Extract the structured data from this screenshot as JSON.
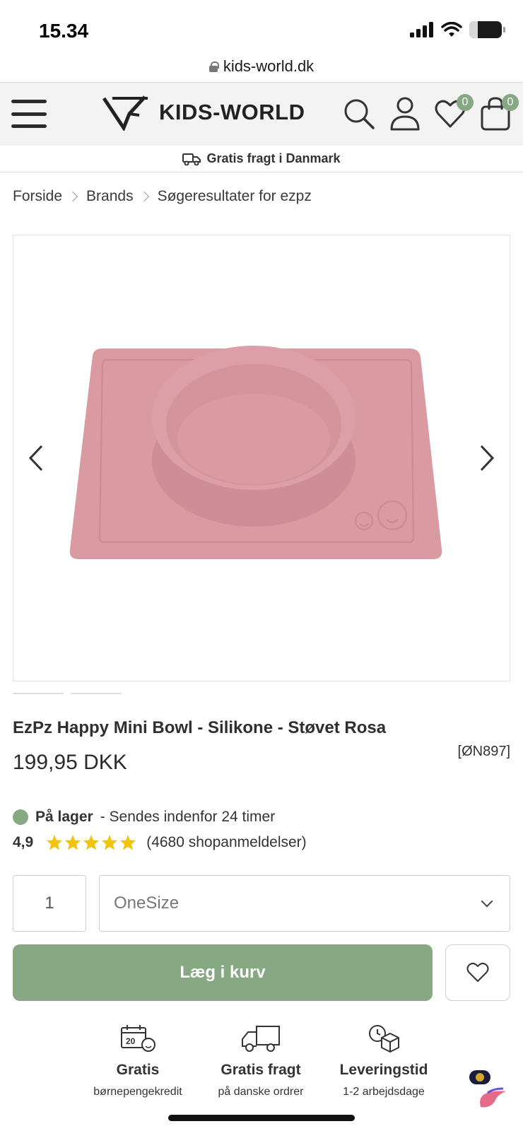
{
  "status_bar": {
    "time": "15.34",
    "battery": "26"
  },
  "browser": {
    "url": "kids-world.dk"
  },
  "header": {
    "logo_text": "KIDS-WORLD",
    "wishlist_count": "0",
    "cart_count": "0",
    "shipping_banner": "Gratis fragt i Danmark"
  },
  "breadcrumb": [
    "Forside",
    "Brands",
    "Søgeresultater for ezpz"
  ],
  "product": {
    "title": "EzPz Happy Mini Bowl - Silikone - Støvet Rosa",
    "price": "199,95 DKK",
    "sku": "[ØN897]",
    "stock_label": "På lager",
    "stock_note": "- Sendes indenfor 24 timer",
    "rating_score": "4,9",
    "rating_stars": 5,
    "reviews": "(4680 shopanmeldelser)",
    "quantity": "1",
    "size_selected": "OneSize",
    "add_to_cart": "Læg i kurv",
    "image_color": "#d99aa2"
  },
  "usps": [
    {
      "title": "Gratis",
      "sub": "børnepengekredit",
      "icon": "calendar-smile-icon"
    },
    {
      "title": "Gratis fragt",
      "sub": "på danske ordrer",
      "icon": "truck-icon"
    },
    {
      "title": "Leveringstid",
      "sub": "1-2 arbejdsdage",
      "icon": "clock-box-icon"
    }
  ],
  "colors": {
    "accent": "#86a882",
    "star": "#f1c40f"
  }
}
